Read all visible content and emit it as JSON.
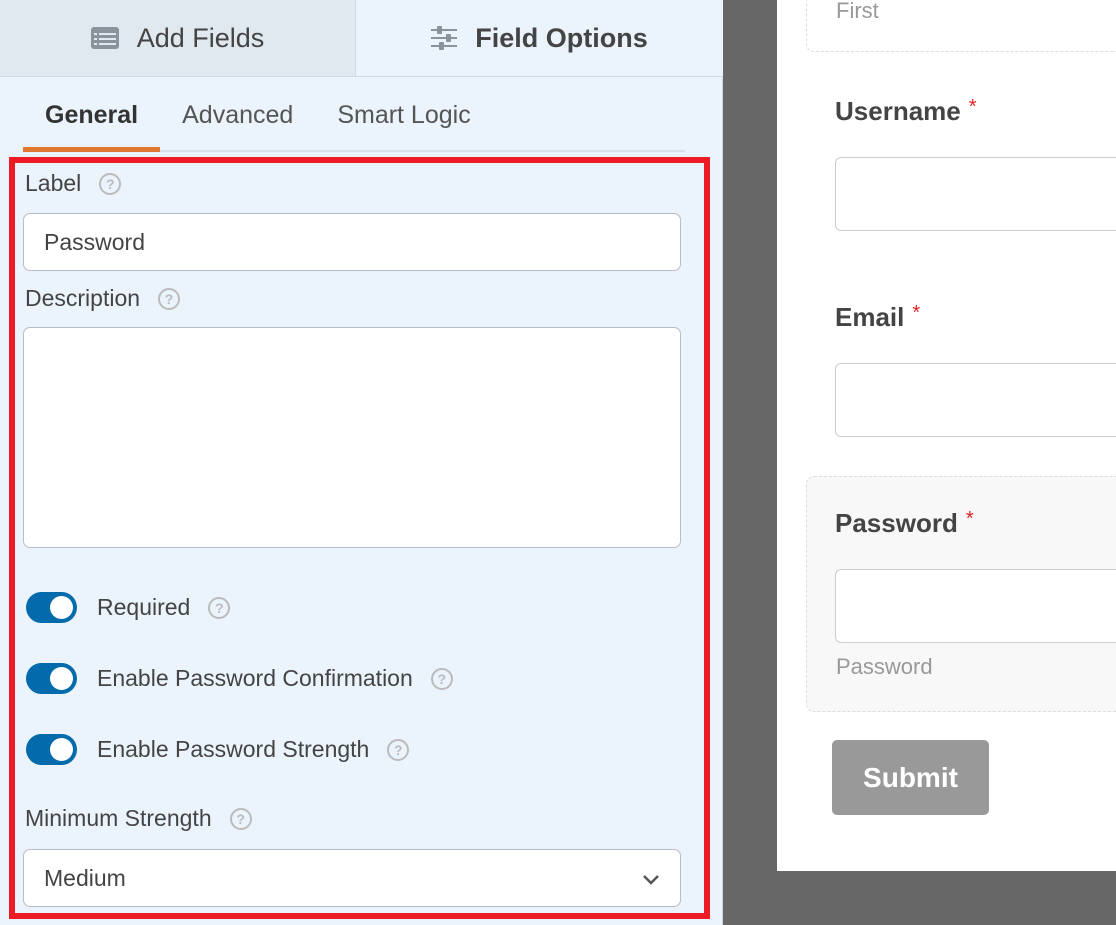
{
  "builder": {
    "top_tabs": [
      {
        "label": "Add Fields",
        "icon": "list-icon",
        "active": false
      },
      {
        "label": "Field Options",
        "icon": "sliders-icon",
        "active": true
      }
    ],
    "sub_tabs": [
      {
        "label": "General",
        "active": true
      },
      {
        "label": "Advanced",
        "active": false
      },
      {
        "label": "Smart Logic",
        "active": false
      }
    ],
    "help_glyph": "?",
    "label_field": {
      "label": "Label",
      "value": "Password"
    },
    "description_field": {
      "label": "Description",
      "value": ""
    },
    "toggles": [
      {
        "label": "Required",
        "on": true
      },
      {
        "label": "Enable Password Confirmation",
        "on": true
      },
      {
        "label": "Enable Password Strength",
        "on": true
      }
    ],
    "minimum_strength": {
      "label": "Minimum Strength",
      "value": "Medium"
    },
    "highlight_color": "#ed1c24",
    "accent_color": "#036aab",
    "active_tab_underline": "#e27730"
  },
  "preview": {
    "name_sublabel": "First",
    "fields": [
      {
        "label": "Username",
        "required_mark": "*"
      },
      {
        "label": "Email",
        "required_mark": "*"
      },
      {
        "label": "Password",
        "required_mark": "*",
        "sublabel": "Password"
      }
    ],
    "submit_label": "Submit"
  }
}
